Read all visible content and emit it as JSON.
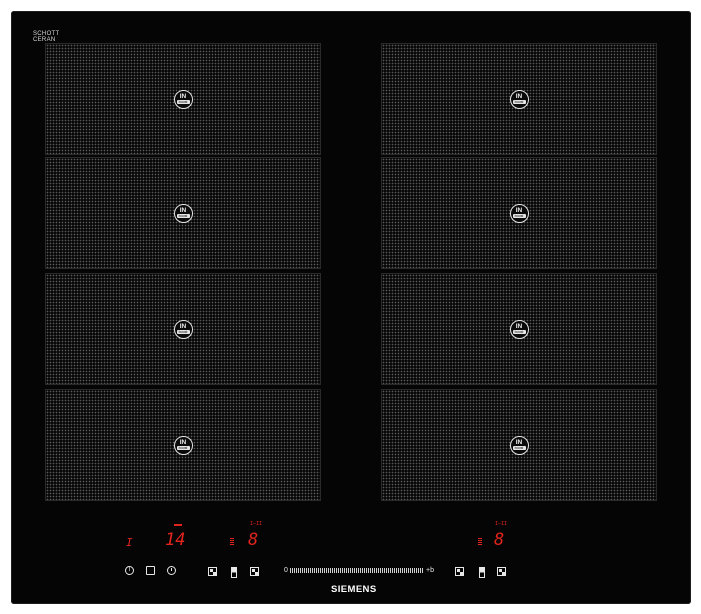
{
  "brand": {
    "mark_line1": "SCHOTT",
    "mark_line2": "CERAN",
    "logo": "SIEMENS"
  },
  "zones": [
    {
      "badge_top": "IN",
      "badge_bottom": "boost"
    },
    {
      "badge_top": "IN",
      "badge_bottom": "boost"
    },
    {
      "badge_top": "IN",
      "badge_bottom": "boost"
    },
    {
      "badge_top": "IN",
      "badge_bottom": "boost"
    },
    {
      "badge_top": "IN",
      "badge_bottom": "boost"
    },
    {
      "badge_top": "IN",
      "badge_bottom": "boost"
    },
    {
      "badge_top": "IN",
      "badge_bottom": "boost"
    },
    {
      "badge_top": "IN",
      "badge_bottom": "boost"
    }
  ],
  "displays": {
    "left_indicator": "I",
    "timer_value": "14",
    "left_power": "8",
    "left_mini_label": "I—II",
    "right_power": "8",
    "right_mini_label": "I—II"
  },
  "controls": {
    "power_symbol": "I",
    "slider_min": "0",
    "slider_max": "+b"
  },
  "colors": {
    "led": "#e2241c",
    "glass": "#050505",
    "print": "#e8e8e8"
  }
}
